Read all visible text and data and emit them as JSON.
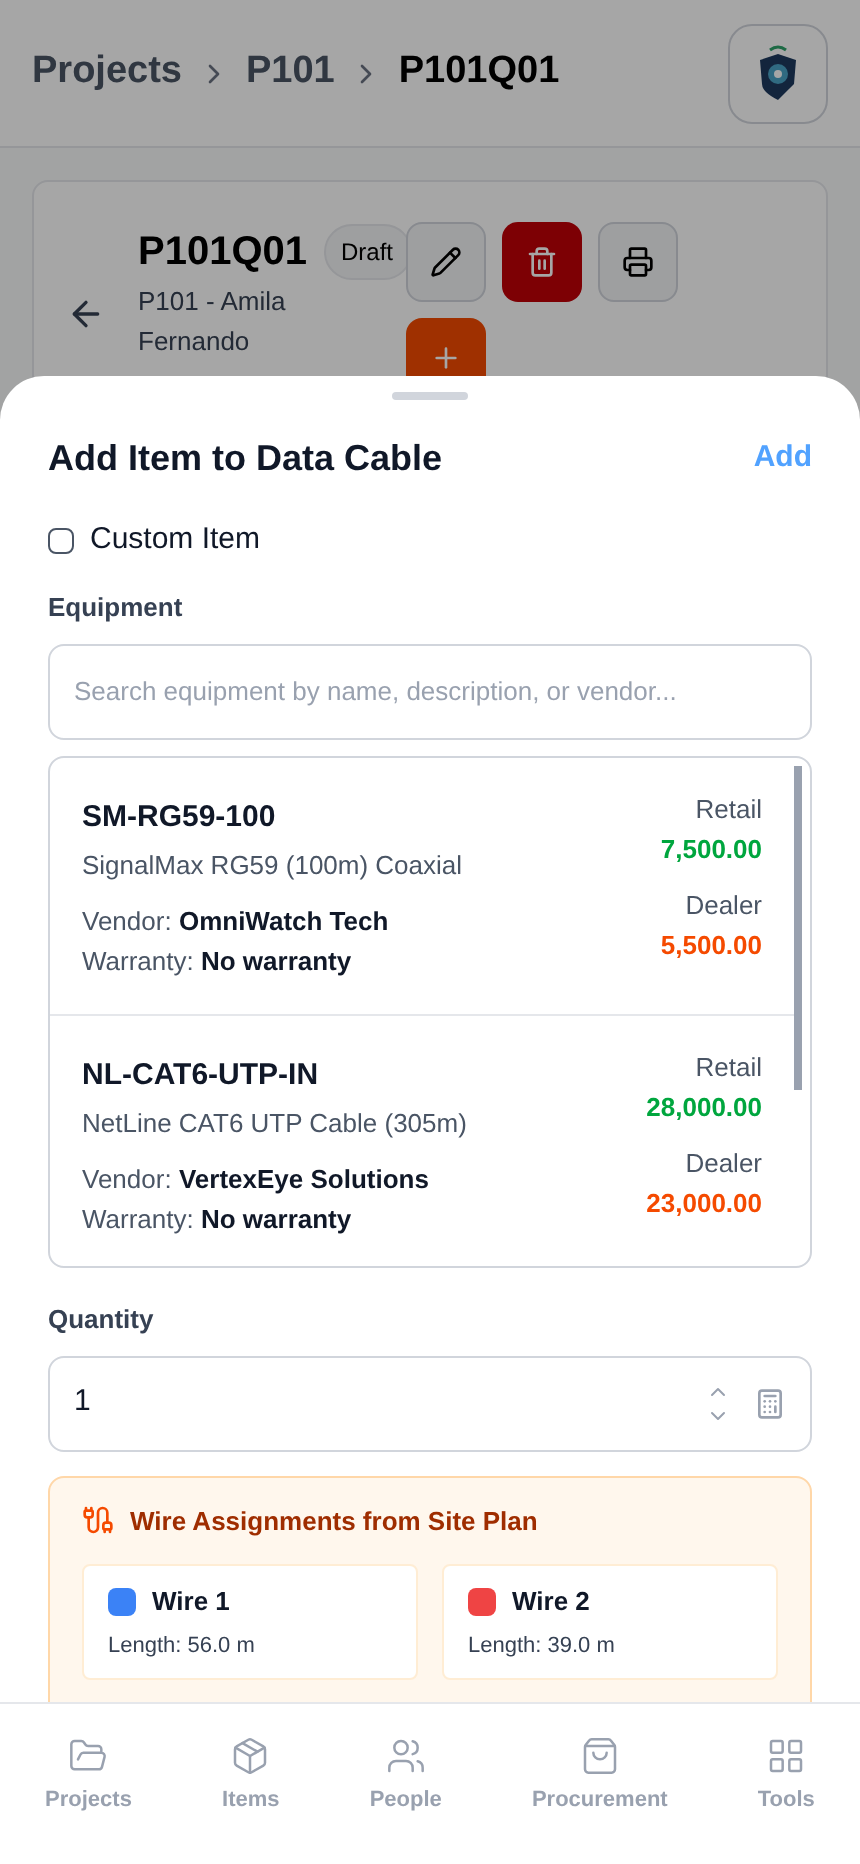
{
  "breadcrumb": [
    "Projects",
    "P101",
    "P101Q01"
  ],
  "quote": {
    "title": "P101Q01",
    "status": "Draft",
    "client": "P101 - Amila Fernando"
  },
  "sheet": {
    "title": "Add Item to Data Cable",
    "action": "Add",
    "custom_item": {
      "label": "Custom Item",
      "checked": false
    },
    "equipment_label": "Equipment",
    "search": {
      "placeholder": "Search equipment by name, description, or vendor..."
    },
    "equipment": [
      {
        "code": "SM-RG59-100",
        "description": "SignalMax RG59 (100m) Coaxial",
        "vendor_label": "Vendor:",
        "vendor": "OmniWatch Tech",
        "warranty_label": "Warranty:",
        "warranty": "No warranty",
        "retail_label": "Retail",
        "retail": "7,500.00",
        "dealer_label": "Dealer",
        "dealer": "5,500.00"
      },
      {
        "code": "NL-CAT6-UTP-IN",
        "description": "NetLine CAT6 UTP Cable (305m)",
        "vendor_label": "Vendor:",
        "vendor": "VertexEye Solutions",
        "warranty_label": "Warranty:",
        "warranty": "No warranty",
        "retail_label": "Retail",
        "retail": "28,000.00",
        "dealer_label": "Dealer",
        "dealer": "23,000.00"
      }
    ],
    "quantity_label": "Quantity",
    "quantity": "1",
    "wires": {
      "title": "Wire Assignments from Site Plan",
      "items": [
        {
          "name": "Wire 1",
          "color": "#3b82f6",
          "length": "Length: 56.0 m"
        },
        {
          "name": "Wire 2",
          "color": "#ef4444",
          "length": "Length: 39.0 m"
        }
      ]
    }
  },
  "nav": [
    {
      "label": "Projects",
      "kind": "folder"
    },
    {
      "label": "Items",
      "kind": "box"
    },
    {
      "label": "People",
      "kind": "people"
    },
    {
      "label": "Procurement",
      "kind": "bag"
    },
    {
      "label": "Tools",
      "kind": "grid"
    }
  ]
}
